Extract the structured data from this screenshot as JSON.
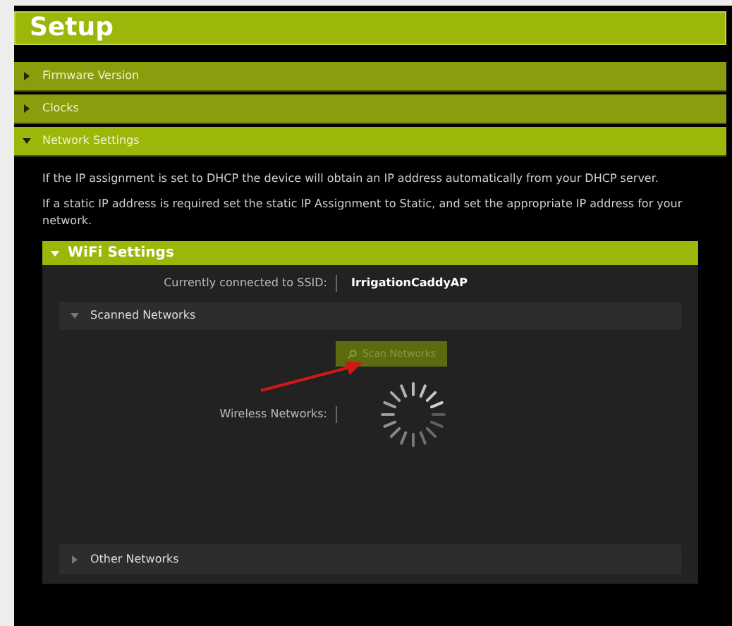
{
  "title": "Setup",
  "sections": [
    {
      "label": "Firmware Version",
      "expanded": false
    },
    {
      "label": "Clocks",
      "expanded": false
    },
    {
      "label": "Network Settings",
      "expanded": true
    }
  ],
  "paragraphs": [
    "If the IP assignment is set to DHCP the device will obtain an IP address automatically from your DHCP server.",
    "If a static IP address is required set the static IP Assignment to Static, and set the appropriate IP address for your network."
  ],
  "wifi": {
    "title": "WiFi Settings",
    "expanded": true,
    "ssid_label": "Currently connected to SSID:",
    "ssid_value": "IrrigationCaddyAP",
    "scanned": {
      "label": "Scanned Networks",
      "expanded": true,
      "button": {
        "label": "Scan Networks",
        "disabled": true
      },
      "networks_label": "Wireless Networks:",
      "loading": true
    },
    "other": {
      "label": "Other Networks",
      "expanded": false
    }
  }
}
